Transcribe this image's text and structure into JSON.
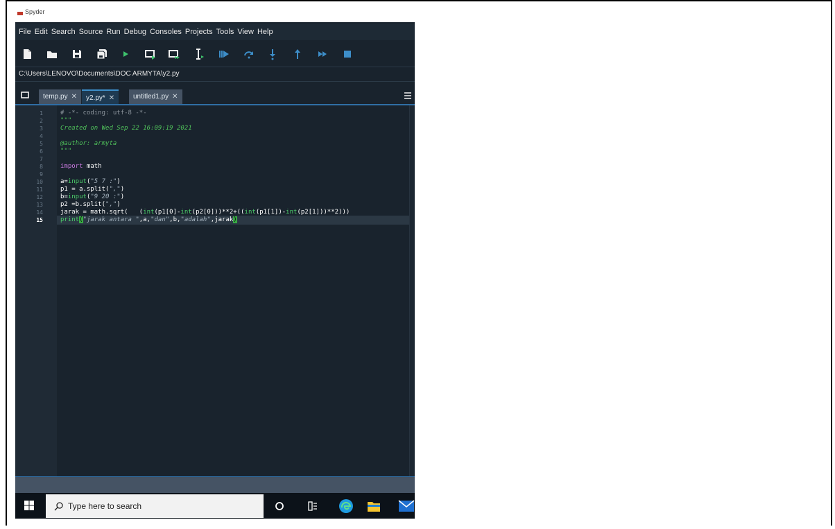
{
  "window": {
    "title": "Spyder"
  },
  "menu": [
    "File",
    "Edit",
    "Search",
    "Source",
    "Run",
    "Debug",
    "Consoles",
    "Projects",
    "Tools",
    "View",
    "Help"
  ],
  "toolbar_icons": [
    "new-file-icon",
    "open-folder-icon",
    "save-icon",
    "save-all-icon",
    "run-icon",
    "run-cell-icon",
    "run-cell-advance-icon",
    "run-selection-icon",
    "debug-icon",
    "step-over-icon",
    "step-into-icon",
    "step-return-icon",
    "continue-icon",
    "stop-icon"
  ],
  "path": "C:\\Users\\LENOVO\\Documents\\DOC ARMYTA\\y2.py",
  "tabs": [
    {
      "label": "temp.py",
      "active": false
    },
    {
      "label": "y2.py*",
      "active": true
    },
    {
      "label": "untitled1.py",
      "active": false
    }
  ],
  "editor": {
    "current_line": 15,
    "lines": [
      "# -*- coding: utf-8 -*-",
      "\"\"\"",
      "Created on Wed Sep 22 16:09:19 2021",
      "",
      "@author: armyta",
      "\"\"\"",
      "",
      "import math",
      "",
      "a=input(\"5 7 :\")",
      "p1 = a.split(\",\")",
      "b=input(\"9 20 :\")",
      "p2 =b.split(\",\")",
      "jarak = math.sqrt(   (int(p1[0]-int(p2[0]))**2+((int(p1[1])-int(p2[1]))**2)))",
      "print(\"jarak antara \",a,\"dan\",b,\"adalah\",jarak)"
    ]
  },
  "taskbar": {
    "search_placeholder": "Type here to search"
  },
  "colors": {
    "bg": "#19232d",
    "gutter": "#1f2a35",
    "accent": "#2f6ea5",
    "docstring": "#4fbf5a",
    "keyword": "#c678dd"
  }
}
